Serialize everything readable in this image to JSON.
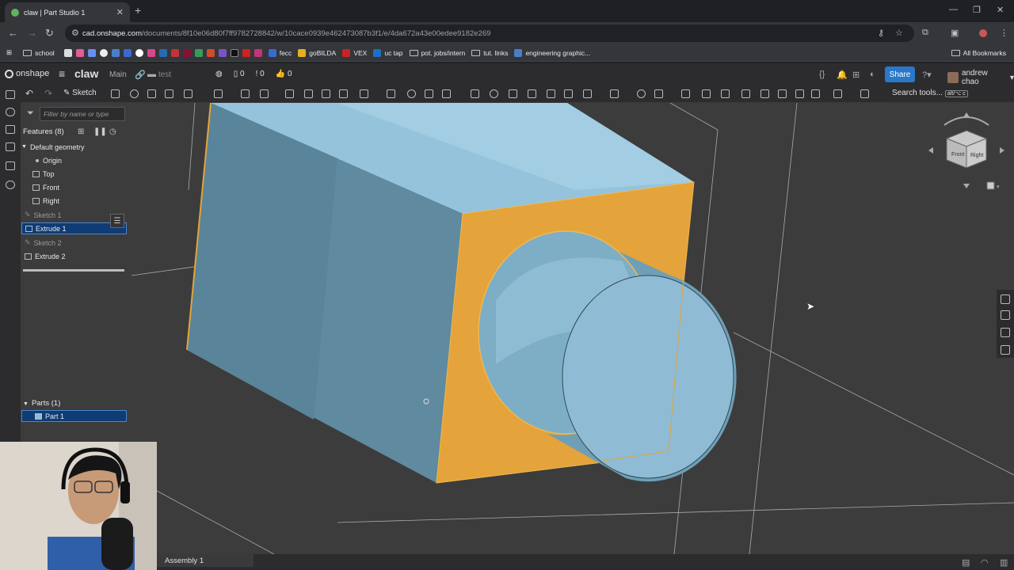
{
  "browser": {
    "tab_title": "claw | Part Studio 1",
    "tab_close": "✕",
    "new_tab": "+",
    "url_domain": "cad.onshape.com",
    "url_path": "/documents/8f10e06d80f7ff9782728842/w/10cace0939e462473087b3f1/e/4da672a43e00edee9182e269",
    "window_controls": [
      "—",
      "❐",
      "✕"
    ]
  },
  "bookmarks": {
    "items": [
      "school",
      "fecc",
      "goBILDA",
      "VEX",
      "uc tap",
      "pot. jobs/intern",
      "tut. links",
      "engineering graphic..."
    ],
    "all_bookmarks": "All Bookmarks"
  },
  "app": {
    "logo": "onshape",
    "document_name": "claw",
    "branch": "Main",
    "workspace": "test",
    "counters": [
      "0",
      "0",
      "0"
    ],
    "share_label": "Share",
    "user_name": "andrew chao"
  },
  "toolbar": {
    "sketch_label": "Sketch",
    "search_tools": "Search tools...",
    "search_shortcut": "alt/⌥ c"
  },
  "feature_panel": {
    "filter_placeholder": "Filter by name or type",
    "features_header": "Features (8)",
    "default_geometry": "Default geometry",
    "geometry_items": [
      "Origin",
      "Top",
      "Front",
      "Right"
    ],
    "features": [
      "Sketch 1",
      "Extrude 1",
      "Sketch 2",
      "Extrude 2"
    ],
    "parts_header": "Parts (1)",
    "parts": [
      "Part 1"
    ]
  },
  "viewcube": {
    "front": "Front",
    "right": "Right"
  },
  "bottom": {
    "tab_assembly": "Assembly 1"
  },
  "colors": {
    "accent": "#2a78c8",
    "selected_face": "#e4a33b",
    "part_body": "#8fbcd4",
    "viewport_bg": "#3c3c3c"
  }
}
